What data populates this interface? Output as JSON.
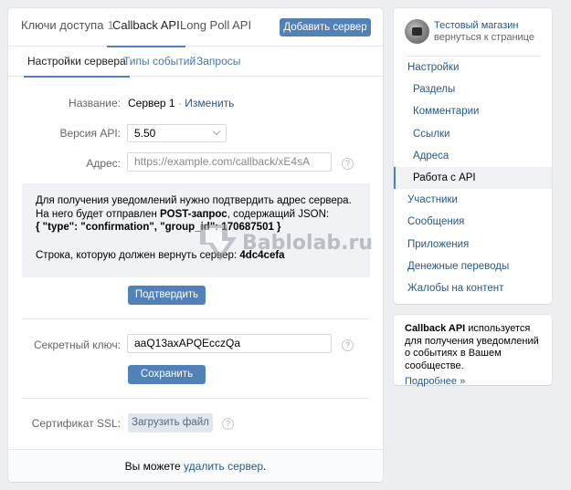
{
  "tabs": [
    {
      "label": "Ключи доступа",
      "count": "1"
    },
    {
      "label": "Callback API"
    },
    {
      "label": "Long Poll API"
    }
  ],
  "add_server_label": "Добавить сервер",
  "subtabs": [
    "Настройки сервера",
    "Типы событий",
    "Запросы"
  ],
  "form": {
    "name_label": "Название:",
    "name_value": "Сервер 1",
    "name_separator": " · ",
    "change_link": "Изменить",
    "api_version_label": "Версия API:",
    "api_version_value": "5.50",
    "address_label": "Адрес:",
    "address_placeholder": "https://example.com/callback/xE4sA",
    "help_glyph": "?"
  },
  "notice": {
    "line1_a": "Для получения уведомлений нужно подтвердить адрес сервера. На него будет отправлен ",
    "line1_bold": "POST-запрос",
    "line1_b": ", содержащий JSON:",
    "json": "{ \"type\": \"confirmation\", \"group_id\": 170687501 }",
    "line2_a": "Строка, которую должен вернуть сервер: ",
    "line2_bold": "4dc4cefa"
  },
  "confirm_label": "Подтвердить",
  "secret": {
    "label": "Секретный ключ:",
    "value": "aaQ13axAPQEcczQa",
    "save_label": "Сохранить"
  },
  "ssl": {
    "label": "Сертификат SSL:",
    "upload_label": "Загрузить файл"
  },
  "footer": {
    "text_a": "Вы можете ",
    "link": "удалить сервер",
    "text_b": "."
  },
  "watermark_text": "Bablolab.ru",
  "sidebar": {
    "shop_name": "Тестовый магазин",
    "back_link": "вернуться к странице",
    "items": [
      {
        "label": "Настройки",
        "level": "top"
      },
      {
        "label": "Разделы",
        "level": "sub"
      },
      {
        "label": "Комментарии",
        "level": "sub"
      },
      {
        "label": "Ссылки",
        "level": "sub"
      },
      {
        "label": "Адреса",
        "level": "sub"
      },
      {
        "label": "Работа с API",
        "level": "sub",
        "active": true
      },
      {
        "label": "Участники",
        "level": "top"
      },
      {
        "label": "Сообщения",
        "level": "top"
      },
      {
        "label": "Приложения",
        "level": "top"
      },
      {
        "label": "Денежные переводы",
        "level": "top"
      },
      {
        "label": "Жалобы на контент",
        "level": "top"
      }
    ]
  },
  "info": {
    "bold": "Callback API",
    "text": " используется для получения уведомлений о событиях в Вашем сообществе.",
    "more": "Подробнее »"
  },
  "colors": {
    "accent": "#5181b8",
    "link": "#2a5885",
    "page_bg": "#edeef0"
  }
}
